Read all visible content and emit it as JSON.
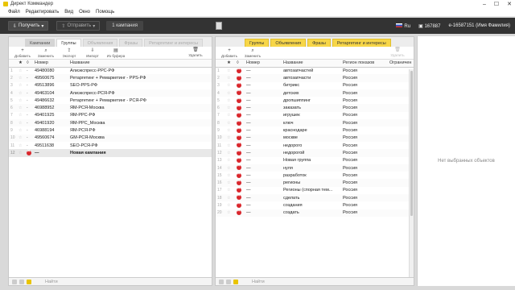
{
  "window": {
    "title": "Директ Коммандер",
    "controls": [
      "–",
      "☐",
      "✕"
    ]
  },
  "menu": [
    "Файл",
    "Редактировать",
    "Вид",
    "Окно",
    "Помощь"
  ],
  "toolbar": {
    "get_label": "Получить",
    "send_label": "Отправить",
    "campaigns_tab": "1 кампания",
    "lang": "Ru",
    "counter": "167887",
    "account": "e-16587151 (Имя Фамилия)"
  },
  "left_panel": {
    "tabs": [
      "Кампании",
      "Группы",
      "Объявления",
      "Фразы",
      "Ретаргетинг и интересы"
    ],
    "actions": [
      "Добавить",
      "Заменить",
      "Экспорт",
      "Импорт",
      "Из буфера"
    ],
    "delete_label": "Удалить",
    "columns": {
      "num": "Номер",
      "name": "Название"
    },
    "rows": [
      {
        "idx": "1",
        "num": "49480080",
        "name": "Алиэкспресс-РРС-РФ"
      },
      {
        "idx": "2",
        "num": "49560675",
        "name": "Ретаргетинг + Ремаркетинг - РРS-РФ"
      },
      {
        "idx": "3",
        "num": "49513896",
        "name": "SEO-РРS-РФ"
      },
      {
        "idx": "4",
        "num": "49463104",
        "name": "Алиэкспресс-РСЯ-РФ"
      },
      {
        "idx": "5",
        "num": "49486632",
        "name": "Ретаргетинг + Ремаркетинг - РСЯ-РФ"
      },
      {
        "idx": "6",
        "num": "46988952",
        "name": "ЯМ-РСЯ-Москва"
      },
      {
        "idx": "7",
        "num": "49401925",
        "name": "ЯМ-РРС-РФ"
      },
      {
        "idx": "8",
        "num": "49401920",
        "name": "ЯМ-РРС_Москва"
      },
      {
        "idx": "9",
        "num": "46988194",
        "name": "ЯМ-РСЯ-РФ"
      },
      {
        "idx": "10",
        "num": "49560674",
        "name": "GM-РСЯ-Москва"
      },
      {
        "idx": "11",
        "num": "49511638",
        "name": "SEO-РСЯ-РФ"
      }
    ],
    "new_row": {
      "idx": "12",
      "num": "—",
      "name": "Новая кампания"
    },
    "find_label": "Найти"
  },
  "mid_panel": {
    "tabs": [
      "Группы",
      "Объявления",
      "Фразы",
      "Ретаргетинг и интересы"
    ],
    "actions": [
      "Добавить",
      "Заменить"
    ],
    "delete_label": "Удалить",
    "columns": {
      "num": "Номер",
      "name": "Название",
      "region": "Регион показов",
      "limit": "Ограничен"
    },
    "rows": [
      {
        "idx": "1",
        "name": "автозапчастей",
        "region": "Россия"
      },
      {
        "idx": "2",
        "name": "автозапчасти",
        "region": "Россия"
      },
      {
        "idx": "3",
        "name": "битрикс",
        "region": "Россия"
      },
      {
        "idx": "4",
        "name": "детских",
        "region": "Россия"
      },
      {
        "idx": "5",
        "name": "дропшиппинг",
        "region": "Россия"
      },
      {
        "idx": "6",
        "name": "заказать",
        "region": "Россия"
      },
      {
        "idx": "7",
        "name": "игрушек",
        "region": "Россия"
      },
      {
        "idx": "8",
        "name": "ключ",
        "region": "Россия"
      },
      {
        "idx": "9",
        "name": "краснодаре",
        "region": "Россия"
      },
      {
        "idx": "10",
        "name": "москве",
        "region": "Россия"
      },
      {
        "idx": "11",
        "name": "недорого",
        "region": "Россия"
      },
      {
        "idx": "12",
        "name": "недорогой",
        "region": "Россия"
      },
      {
        "idx": "13",
        "name": "Новая группа",
        "region": "Россия"
      },
      {
        "idx": "14",
        "name": "нуля",
        "region": "Россия"
      },
      {
        "idx": "15",
        "name": "разработок",
        "region": "Россия"
      },
      {
        "idx": "16",
        "name": "регионы",
        "region": "Россия"
      },
      {
        "idx": "17",
        "name": "Регионы (спорная тем...",
        "region": "Россия"
      },
      {
        "idx": "18",
        "name": "сделать",
        "region": "Россия"
      },
      {
        "idx": "19",
        "name": "создания",
        "region": "Россия"
      },
      {
        "idx": "20",
        "name": "создать",
        "region": "Россия"
      }
    ],
    "dash": "—",
    "find_label": "Найти"
  },
  "right_pane": {
    "empty_text": "Нет выбранных объектов"
  },
  "colors": {
    "accent": "#f7d648",
    "toolbar": "#333333",
    "stop": "#d9262c"
  }
}
